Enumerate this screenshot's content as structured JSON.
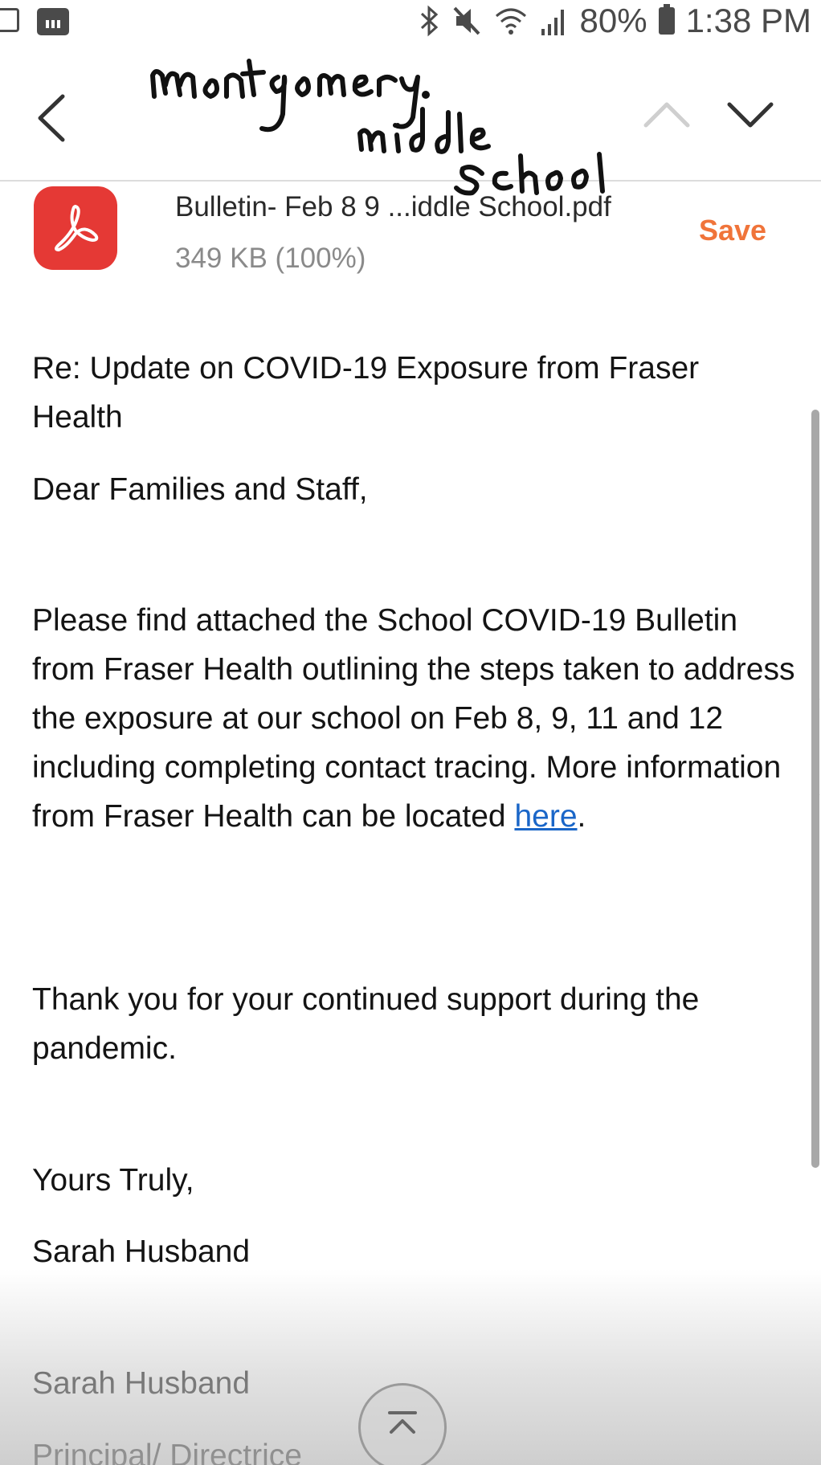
{
  "status_bar": {
    "battery": "80%",
    "time": "1:38 PM",
    "icons": [
      "gallery-icon",
      "calendar-icon",
      "bluetooth-icon",
      "mute-icon",
      "wifi-icon",
      "signal-icon",
      "battery-icon"
    ]
  },
  "header": {
    "handwritten_note": [
      "Montgomery.",
      "middle",
      "School"
    ],
    "nav_icons": [
      "back-icon",
      "chevron-up-icon",
      "chevron-down-icon"
    ]
  },
  "attachment": {
    "file_name": "Bulletin- Feb 8 9 ...iddle School.pdf",
    "file_size": "349 KB (100%)",
    "save_label": "Save",
    "icon": "pdf-icon",
    "icon_color": "#e53935"
  },
  "email": {
    "subject_line": "Re: Update on COVID-19 Exposure from Fraser Health",
    "greeting": "Dear Families and Staff,",
    "body_paragraph": "Please find attached the School COVID-19 Bulletin from Fraser Health outlining the steps taken to address the exposure at our school on Feb 8, 9, 11 and 12 including completing contact tracing.  More information from Fraser Health can be located ",
    "link_text": "here",
    "body_paragraph_end": ".",
    "thanks": "Thank you for your continued support during the pandemic.",
    "closing": "Yours Truly,",
    "signature_name": "Sarah Husband",
    "signature_name_repeat": "Sarah Husband",
    "signature_title": "Principal/ Directrice"
  },
  "colors": {
    "accent_save": "#f0743a",
    "link": "#1a66c8"
  }
}
